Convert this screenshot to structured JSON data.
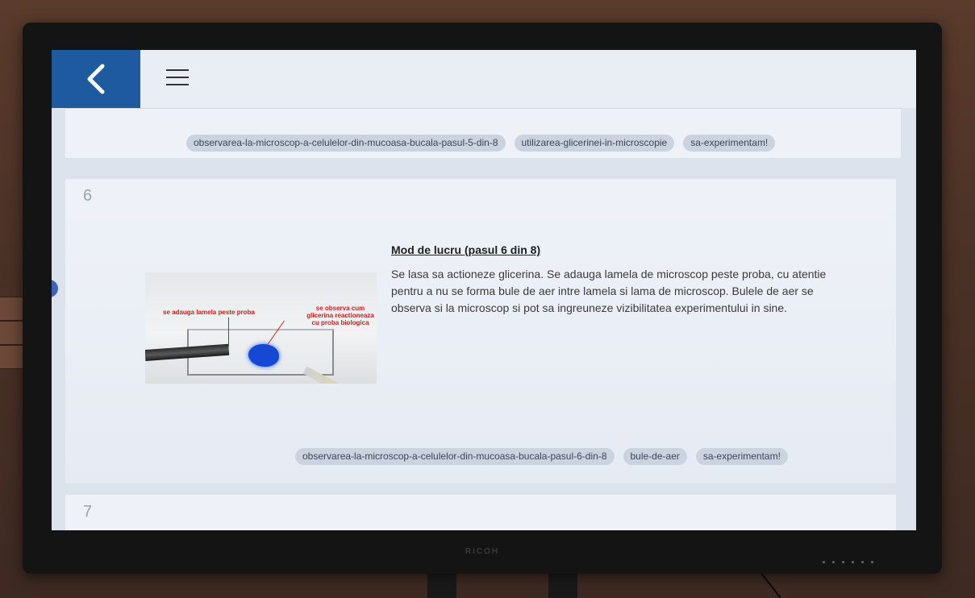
{
  "header": {
    "back_icon": "chevron-left-icon",
    "menu_icon": "hamburger-menu-icon"
  },
  "previous_card": {
    "tags": [
      "observarea-la-microscop-a-celulelor-din-mucoasa-bucala-pasul-5-din-8",
      "utilizarea-glicerinei-in-microscopie",
      "sa-experimentam!"
    ]
  },
  "current_card": {
    "number": "6",
    "title": "Mod de lucru (pasul 6 din 8)",
    "body": "Se lasa sa actioneze glicerina. Se adauga lamela de microscop peste proba, cu atentie pentru a nu se forma bule de aer intre lamela si lama de microscop. Bulele de aer se observa si la microscop si pot sa ingreuneze vizibilitatea experimentului in sine.",
    "image_captions": {
      "left": "se adauga lamela peste proba",
      "right": "se observa cum glicerina reactioneaza cu proba biologica"
    },
    "tags": [
      "observarea-la-microscop-a-celulelor-din-mucoasa-bucala-pasul-6-din-8",
      "bule-de-aer",
      "sa-experimentam!"
    ]
  },
  "next_card": {
    "number": "7"
  },
  "device": {
    "brand": "RICOH"
  },
  "colors": {
    "accent": "#1e5aa0",
    "tag_bg": "#cbd3df",
    "card_bg": "#eef2f8"
  }
}
